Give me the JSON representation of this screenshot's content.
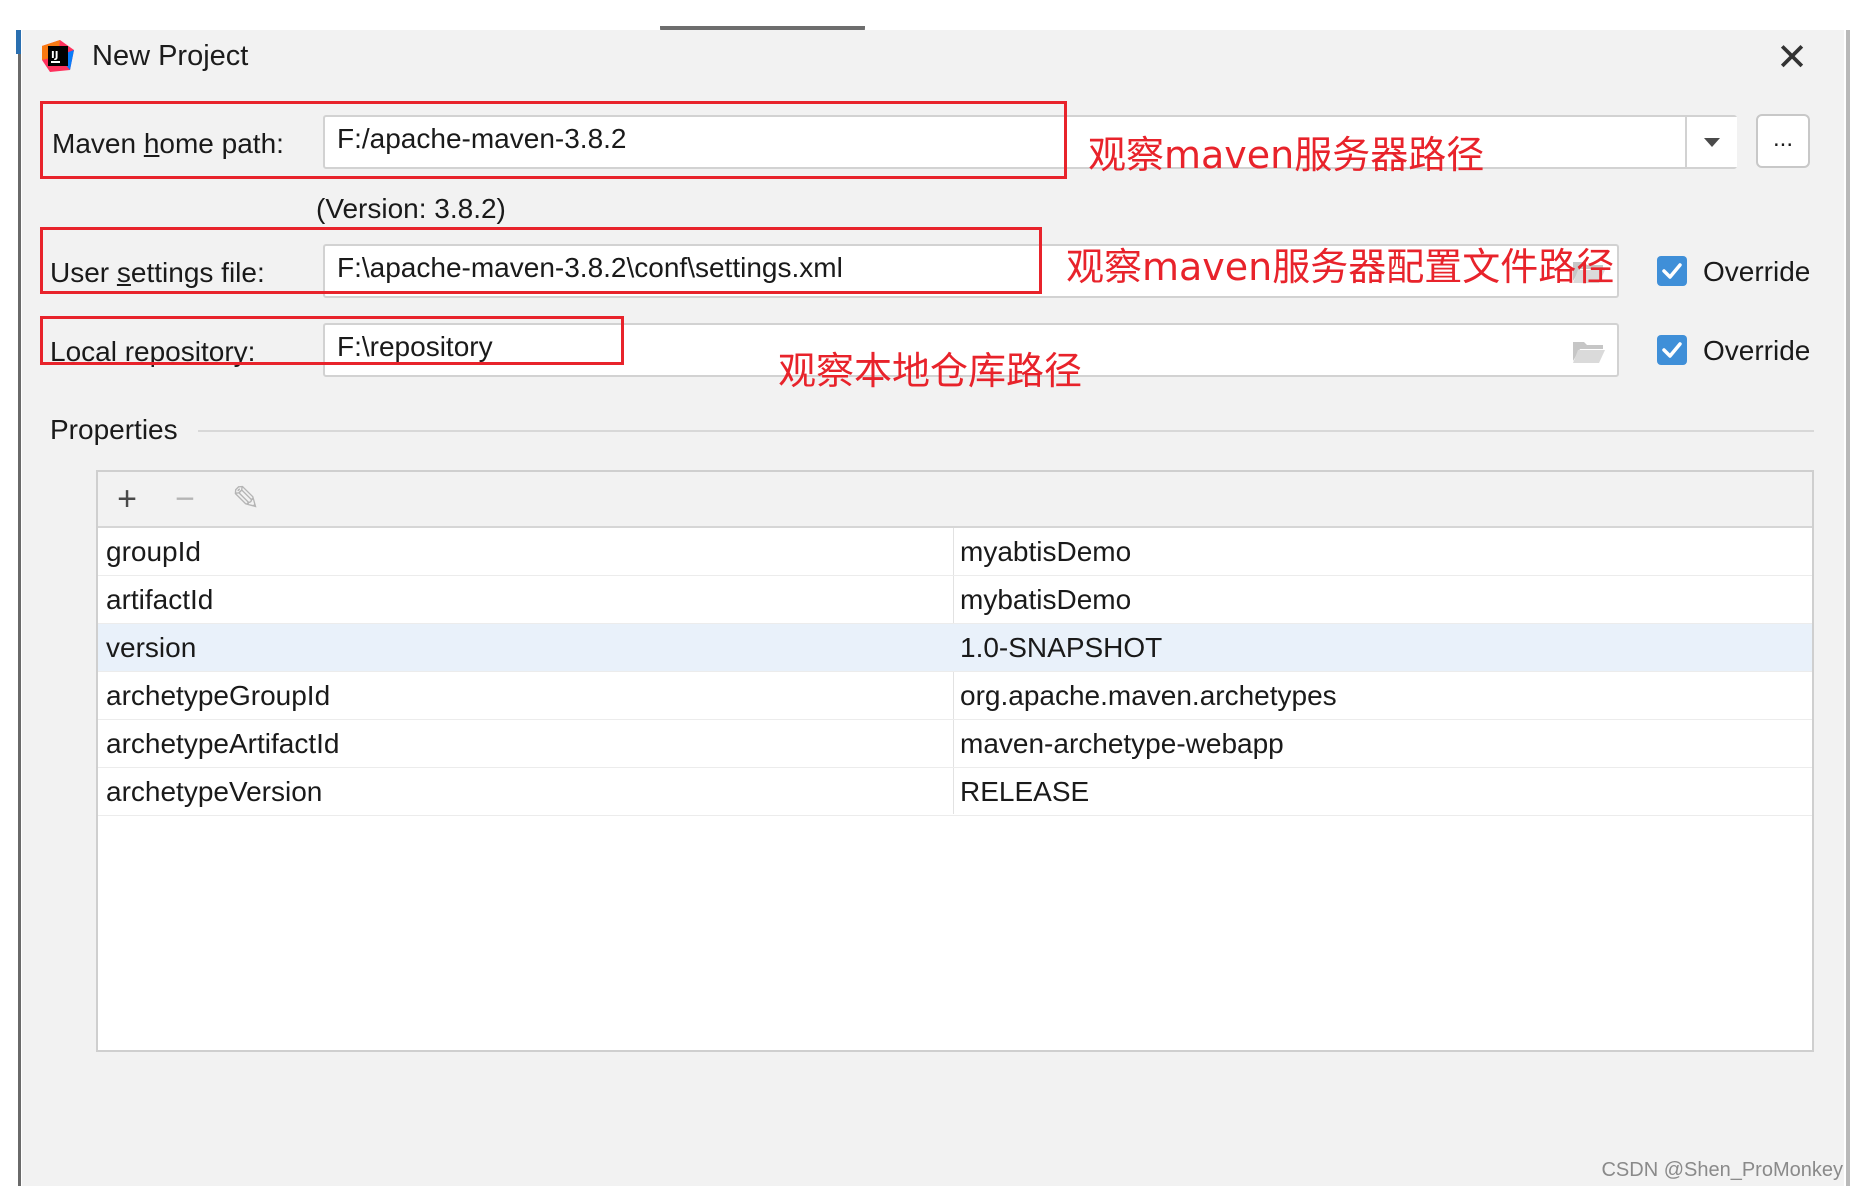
{
  "window": {
    "title": "New Project",
    "close_label": "✕"
  },
  "maven_home": {
    "label_pre": "Maven ",
    "label_mnemonic": "h",
    "label_post": "ome path:",
    "value": "F:/apache-maven-3.8.2",
    "version_text": "(Version: 3.8.2)",
    "browse_label": "..."
  },
  "user_settings": {
    "label_pre": "User ",
    "label_mnemonic": "s",
    "label_post": "ettings file:",
    "value": "F:\\apache-maven-3.8.2\\conf\\settings.xml",
    "override_label": "Override",
    "override_checked": true
  },
  "local_repo": {
    "label": "Local repository:",
    "value": "F:\\repository",
    "override_label": "Override",
    "override_checked": true
  },
  "annotations": {
    "maven_home_note": "观察maven服务器路径",
    "user_settings_note": "观察maven服务器配置文件路径",
    "local_repo_note": "观察本地仓库路径",
    "color": "#e8232b"
  },
  "properties": {
    "section_title": "Properties",
    "toolbar": {
      "add_label": "+",
      "remove_label": "−",
      "edit_label": "✎"
    },
    "rows": [
      {
        "key": "groupId",
        "value": "myabtisDemo"
      },
      {
        "key": "artifactId",
        "value": "mybatisDemo"
      },
      {
        "key": "version",
        "value": "1.0-SNAPSHOT"
      },
      {
        "key": "archetypeGroupId",
        "value": "org.apache.maven.archetypes"
      },
      {
        "key": "archetypeArtifactId",
        "value": "maven-archetype-webapp"
      },
      {
        "key": "archetypeVersion",
        "value": "RELEASE"
      }
    ],
    "selected_row": "version"
  },
  "watermark": "CSDN @Shen_ProMonkey",
  "colors": {
    "accent": "#3f8fd8",
    "dialog_bg": "#f2f2f2",
    "selected_row_bg": "#e9f1fa"
  }
}
